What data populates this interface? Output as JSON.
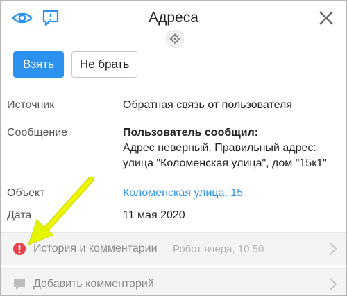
{
  "header": {
    "title": "Адреса",
    "icons": [
      "eye-icon",
      "feedback-icon",
      "close-icon",
      "target-icon"
    ]
  },
  "actions": {
    "take_label": "Взять",
    "skip_label": "Не брать"
  },
  "details": {
    "source_label": "Источник",
    "source_value": "Обратная связь от пользователя",
    "message_label": "Сообщение",
    "message_title": "Пользователь сообщил:",
    "message_line1": "Адрес неверный. Правильный адрес:",
    "message_line2": "улица \"Коломенская улица\", дом \"15к1\"",
    "object_label": "Объект",
    "object_value": "Коломенская улица, 15",
    "date_label": "Дата",
    "date_value": "11 мая 2020"
  },
  "list": {
    "history_label": "История и комментарии",
    "history_meta": "Робот вчера, 10:50",
    "comment_label": "Добавить комментарий"
  },
  "colors": {
    "accent": "#2c92f0",
    "alert": "#e8434a",
    "annotation_arrow": "#e5f500"
  }
}
